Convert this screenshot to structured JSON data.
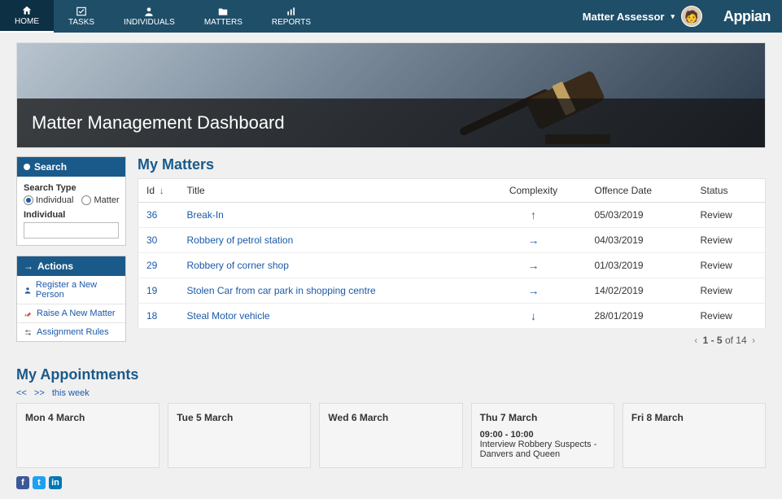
{
  "nav": {
    "home": "HOME",
    "tasks": "TASKS",
    "individuals": "INDIVIDUALS",
    "matters": "MATTERS",
    "reports": "REPORTS",
    "user_label": "Matter Assessor",
    "brand": "Appian"
  },
  "banner": {
    "title": "Matter Management Dashboard"
  },
  "search": {
    "header": "Search",
    "type_label": "Search Type",
    "opt_individual": "Individual",
    "opt_matter": "Matter",
    "field_label": "Individual"
  },
  "actions": {
    "header": "Actions",
    "items": [
      {
        "label": "Register a New Person"
      },
      {
        "label": "Raise A New Matter"
      },
      {
        "label": "Assignment Rules"
      }
    ]
  },
  "matters": {
    "title": "My Matters",
    "cols": {
      "id": "Id",
      "title": "Title",
      "complexity": "Complexity",
      "offence_date": "Offence Date",
      "status": "Status"
    },
    "rows": [
      {
        "id": "36",
        "title": "Break-In",
        "complexity": "up",
        "offence": "05/03/2019",
        "status": "Review"
      },
      {
        "id": "30",
        "title": "Robbery of petrol station",
        "complexity": "right",
        "offence": "04/03/2019",
        "status": "Review"
      },
      {
        "id": "29",
        "title": "Robbery of corner shop",
        "complexity": "right",
        "offence": "01/03/2019",
        "status": "Review"
      },
      {
        "id": "19",
        "title": "Stolen Car from car park in shopping centre",
        "complexity": "right",
        "offence": "14/02/2019",
        "status": "Review"
      },
      {
        "id": "18",
        "title": "Steal Motor vehicle",
        "complexity": "down",
        "offence": "28/01/2019",
        "status": "Review"
      }
    ],
    "pager": {
      "range": "1 - 5",
      "sep": "of",
      "total": "14"
    }
  },
  "appts": {
    "title": "My Appointments",
    "nav_prev": "<<",
    "nav_next": ">>",
    "nav_label": "this week",
    "days": [
      {
        "name": "Mon 4 March",
        "events": []
      },
      {
        "name": "Tue 5 March",
        "events": []
      },
      {
        "name": "Wed 6 March",
        "events": []
      },
      {
        "name": "Thu 7 March",
        "events": [
          {
            "time": "09:00  - 10:00",
            "title": "Interview Robbery Suspects - Danvers and Queen"
          }
        ]
      },
      {
        "name": "Fri 8 March",
        "events": []
      }
    ]
  },
  "social": {
    "fb": "f",
    "tw": "t",
    "li": "in"
  },
  "glyphs": {
    "up": "↑",
    "right": "→",
    "down": "↓",
    "sort": "↓",
    "prev": "‹",
    "next": "›",
    "arrow_r": "→",
    "dropdown": "▾"
  }
}
